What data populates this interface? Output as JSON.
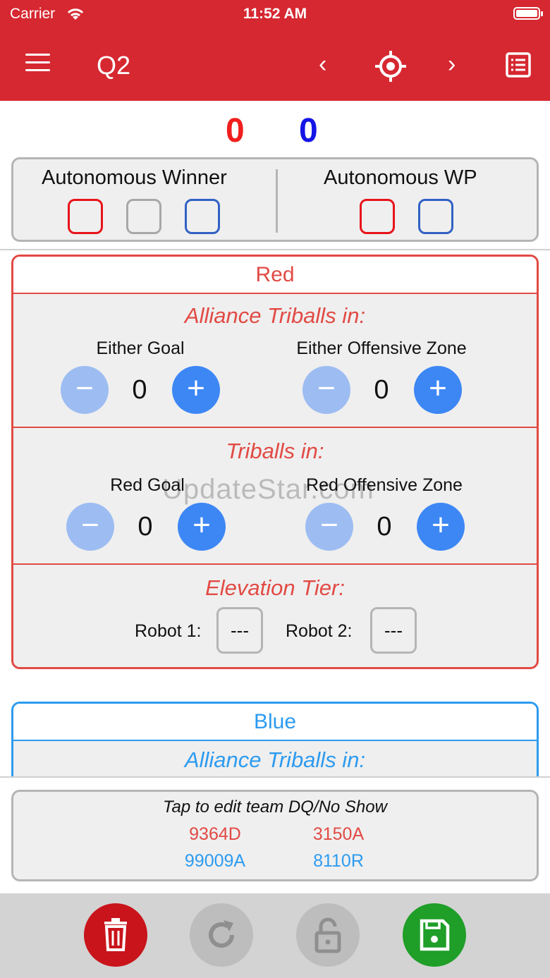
{
  "status": {
    "carrier": "Carrier",
    "time": "11:52 AM"
  },
  "nav": {
    "title": "Q2",
    "prev": "‹",
    "next": "›"
  },
  "scores": {
    "red": "0",
    "blue": "0"
  },
  "autonomous": {
    "winner_label": "Autonomous Winner",
    "wp_label": "Autonomous WP"
  },
  "red": {
    "title": "Red",
    "alliance_header": "Alliance Triballs in:",
    "either_goal": {
      "label": "Either Goal",
      "value": "0"
    },
    "either_zone": {
      "label": "Either Offensive Zone",
      "value": "0"
    },
    "triballs_header": "Triballs in:",
    "red_goal": {
      "label": "Red Goal",
      "value": "0"
    },
    "red_zone": {
      "label": "Red Offensive Zone",
      "value": "0"
    },
    "elevation_header": "Elevation Tier:",
    "robot1_label": "Robot 1:",
    "robot1_value": "---",
    "robot2_label": "Robot 2:",
    "robot2_value": "---"
  },
  "blue": {
    "title": "Blue",
    "alliance_header": "Alliance Triballs in:"
  },
  "teams": {
    "caption": "Tap to edit team DQ/No Show",
    "red1": "9364D",
    "red2": "3150A",
    "blue1": "99009A",
    "blue2": "8110R"
  },
  "signs": {
    "minus": "−",
    "plus": "+"
  },
  "watermark": "UpdateStar.com",
  "colors": {
    "header": "#d62831",
    "red": "#e24a44",
    "blue": "#2d9bf0",
    "plus": "#3d87f5",
    "minus": "#9dbdf2",
    "delete": "#c9141b",
    "save": "#1f9e28",
    "disabled": "#bdbdbd"
  },
  "icons": [
    "menu-icon",
    "chevron-left-icon",
    "crosshair-icon",
    "chevron-right-icon",
    "list-icon",
    "trash-icon",
    "refresh-icon",
    "unlock-icon",
    "save-icon"
  ]
}
